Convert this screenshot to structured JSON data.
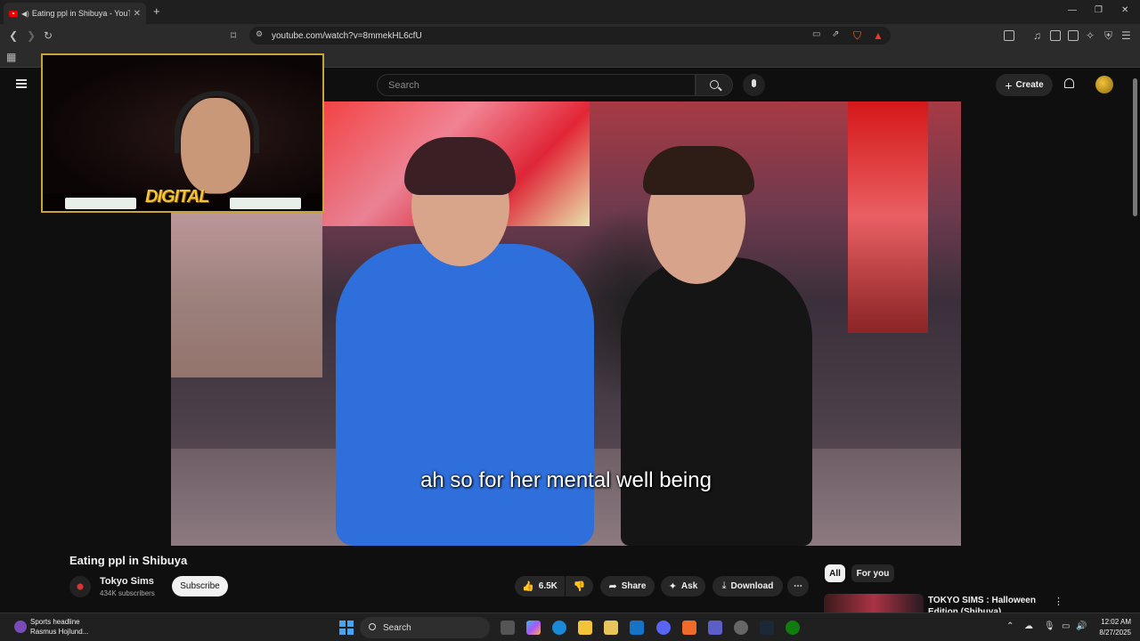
{
  "browser": {
    "tab_title": "Eating ppl in Shibuya - YouTube",
    "url": "youtube.com/watch?v=8mmekHL6cfU"
  },
  "youtube": {
    "search_placeholder": "Search",
    "create_label": "Create"
  },
  "video": {
    "subtitle": "ah so for her mental well being",
    "title": "Eating ppl in Shibuya"
  },
  "webcam": {
    "logo_text": "DIGITAL"
  },
  "channel": {
    "name": "Tokyo Sims",
    "subscribers": "434K subscribers",
    "subscribe_label": "Subscribe"
  },
  "actions": {
    "likes": "6.5K",
    "share": "Share",
    "ask": "Ask",
    "download": "Download"
  },
  "chips": {
    "all": "All",
    "for_you": "For you"
  },
  "recommendation": {
    "title": "TOKYO SIMS : Halloween Edition (Shibuya)"
  },
  "taskbar": {
    "news_title": "Sports headline",
    "news_sub": "Rasmus Hojlund...",
    "search": "Search",
    "time": "12:02 AM",
    "date": "8/27/2025"
  }
}
